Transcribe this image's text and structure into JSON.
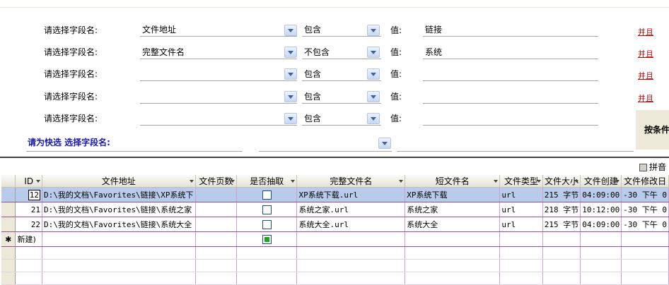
{
  "filters": [
    {
      "label": "请选择字段名:",
      "field": "文件地址",
      "op": "包含",
      "value_label": "值:",
      "value": "链接",
      "conj": "并且"
    },
    {
      "label": "请选择字段名:",
      "field": "完整文件名",
      "op": "不包含",
      "value_label": "值:",
      "value": "系统",
      "conj": "并且"
    },
    {
      "label": "请选择字段名:",
      "field": "",
      "op": "包含",
      "value_label": "值:",
      "value": "",
      "conj": "并且"
    },
    {
      "label": "请选择字段名:",
      "field": "",
      "op": "包含",
      "value_label": "值:",
      "value": "",
      "conj": "并且"
    },
    {
      "label": "请选择字段名:",
      "field": "",
      "op": "包含",
      "value_label": "值:",
      "value": "",
      "conj": ""
    }
  ],
  "quick": {
    "label": "请为快选 选择字段名:",
    "value": ""
  },
  "run_button": "按条件",
  "pinyin_label": "拼音",
  "grid": {
    "columns": [
      "ID",
      "文件地址",
      "文件页数",
      "是否抽取",
      "完整文件名",
      "短文件名",
      "文件类型",
      "文件大小",
      "文件创建",
      "文件修改日"
    ],
    "rows": [
      {
        "id": "12",
        "path": "D:\\我的文档\\Favorites\\链接\\XP系统下",
        "pages": "",
        "extract": false,
        "full": "XP系统下载.url",
        "short": "XP系统下载",
        "type": "url",
        "size": "215 字节",
        "created": "04:09:00",
        "modified": "-30 下午 0"
      },
      {
        "id": "21",
        "path": "D:\\我的文档\\Favorites\\链接\\系统之家",
        "pages": "",
        "extract": false,
        "full": "系统之家.url",
        "short": "系统之家",
        "type": "url",
        "size": "218 字节",
        "created": "10:12:00",
        "modified": "-30 下午 0"
      },
      {
        "id": "22",
        "path": "D:\\我的文档\\Favorites\\链接\\系统大全",
        "pages": "",
        "extract": false,
        "full": "系统大全.url",
        "short": "系统大全",
        "type": "url",
        "size": "215 字节",
        "created": "04:09:00",
        "modified": "-30 下午 0"
      }
    ],
    "new_row_label": "新建)",
    "new_marker": "✱"
  }
}
